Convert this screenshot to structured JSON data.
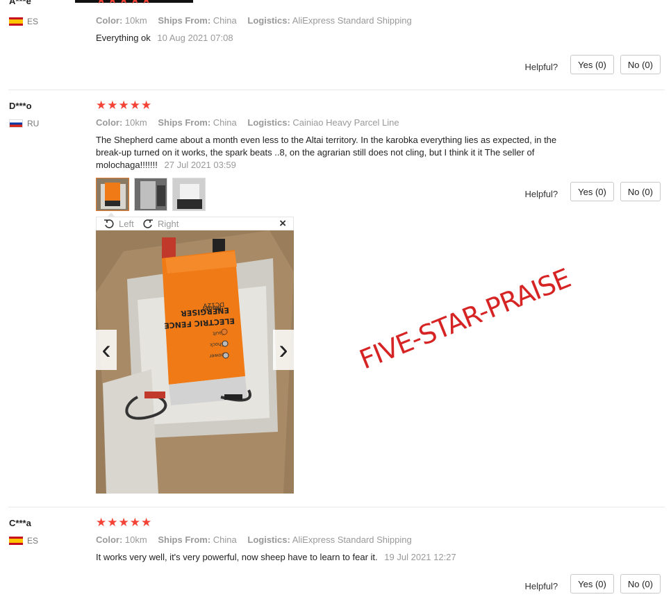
{
  "reviews": [
    {
      "user": "A***e",
      "country": "ES",
      "stars": "★★★★★",
      "color_label": "Color:",
      "color_value": "10km",
      "ships_label": "Ships From:",
      "ships_value": "China",
      "logistics_label": "Logistics:",
      "logistics_value": "AliExpress Standard Shipping",
      "text": "Everything ok",
      "date": "10 Aug 2021 07:08",
      "helpful_label": "Helpful?",
      "yes_label": "Yes (0)",
      "no_label": "No (0)"
    },
    {
      "user": "D***o",
      "country": "RU",
      "stars": "★★★★★",
      "color_label": "Color:",
      "color_value": "10km",
      "ships_label": "Ships From:",
      "ships_value": "China",
      "logistics_label": "Logistics:",
      "logistics_value": "Cainiao Heavy Parcel Line",
      "text": "The Shepherd came about a month even less to the Altai territory. In the karobka everything lies as expected, in the break-up turned on it works, the spark beats ..8, on the agrarian still does not cling, but I think it it The seller of molochaga!!!!!!!",
      "date": "27 Jul 2021 03:59",
      "helpful_label": "Helpful?",
      "yes_label": "Yes (0)",
      "no_label": "No (0)"
    },
    {
      "user": "C***a",
      "country": "ES",
      "stars": "★★★★★",
      "color_label": "Color:",
      "color_value": "10km",
      "ships_label": "Ships From:",
      "ships_value": "China",
      "logistics_label": "Logistics:",
      "logistics_value": "AliExpress Standard Shipping",
      "text": "It works very well, it's very powerful, now sheep have to learn to fear it.",
      "date": "19 Jul 2021 12:27",
      "helpful_label": "Helpful?",
      "yes_label": "Yes (0)",
      "no_label": "No (0)"
    }
  ],
  "viewer": {
    "rotate_left": "Left",
    "rotate_right": "Right",
    "close_glyph": "×",
    "prev_glyph": "‹",
    "next_glyph": "›"
  },
  "product_label": {
    "model": "Model",
    "model_code": "DC12V",
    "line1": "ENERGISER",
    "line2": "ELECTRIC FENCE",
    "fault": "Fault",
    "shock": "Shock",
    "power": "power"
  },
  "stamp": "FIVE-STAR-PRAISE",
  "colors": {
    "star": "#f44336",
    "muted_text": "#999999",
    "stamp": "#d62424",
    "thumb_active": "#e07a2f"
  }
}
